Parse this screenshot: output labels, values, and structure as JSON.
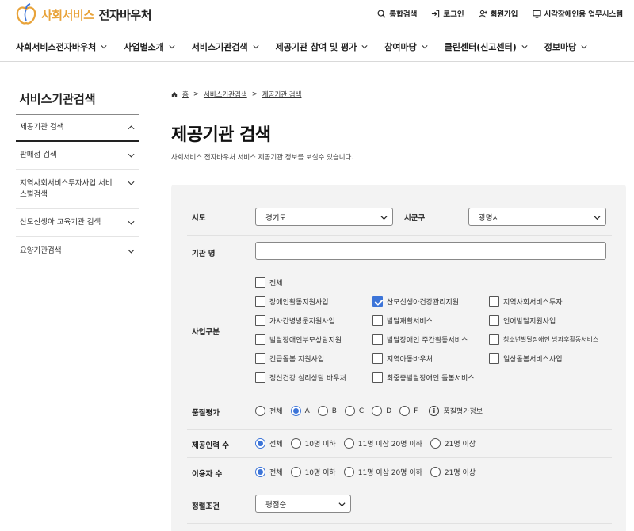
{
  "header": {
    "logo_part1": "사회서비스",
    "logo_part2": "전자바우처",
    "utility": [
      {
        "label": "통합검색",
        "icon": "search-icon"
      },
      {
        "label": "로그인",
        "icon": "login-icon"
      },
      {
        "label": "회원가입",
        "icon": "user-add-icon"
      },
      {
        "label": "시각장애인용 업무시스템",
        "icon": "monitor-icon"
      }
    ]
  },
  "gnb": [
    "사회서비스전자바우처",
    "사업별소개",
    "서비스기관검색",
    "제공기관 참여 및 평가",
    "참여마당",
    "클린센터(신고센터)",
    "정보마당"
  ],
  "sidebar": {
    "title": "서비스기관검색",
    "items": [
      {
        "label": "제공기관 검색",
        "active": true
      },
      {
        "label": "판매점 검색"
      },
      {
        "label": "지역사회서비스투자사업 서비스별검색"
      },
      {
        "label": "산모신생아 교육기관 검색"
      },
      {
        "label": "요양기관검색"
      }
    ]
  },
  "breadcrumb": [
    "홈",
    "서비스기관검색",
    "제공기관 검색"
  ],
  "page": {
    "title": "제공기관 검색",
    "description": "사회서비스 전자바우처 서비스 제공기관 정보를 보실수 있습니다."
  },
  "form": {
    "sido_label": "시도",
    "sido_value": "경기도",
    "sigungu_label": "시군구",
    "sigungu_value": "광명시",
    "name_label": "기관 명",
    "name_value": "",
    "biz_label": "사업구분",
    "biz_options": [
      {
        "label": "전체",
        "checked": false
      },
      {
        "label": "장애인활동지원사업",
        "checked": false
      },
      {
        "label": "산모신생아건강관리지원",
        "checked": true
      },
      {
        "label": "지역사회서비스투자",
        "checked": false
      },
      {
        "label": "가사간병방문지원사업",
        "checked": false
      },
      {
        "label": "발달재활서비스",
        "checked": false
      },
      {
        "label": "언어발달지원사업",
        "checked": false
      },
      {
        "label": "발달장애인부모상담지원",
        "checked": false
      },
      {
        "label": "발달장애인 주간활동서비스",
        "checked": false
      },
      {
        "label": "청소년발달장애인 방과후활동서비스",
        "checked": false
      },
      {
        "label": "긴급돌봄 지원사업",
        "checked": false
      },
      {
        "label": "지역아동바우처",
        "checked": false
      },
      {
        "label": "일상돌봄서비스사업",
        "checked": false
      },
      {
        "label": "정신건강 심리상담 바우처",
        "checked": false
      },
      {
        "label": "최중증발달장애인 돌봄서비스",
        "checked": false
      }
    ],
    "quality_label": "품질평가",
    "quality_options": [
      "전체",
      "A",
      "B",
      "C",
      "D",
      "F"
    ],
    "quality_selected": 1,
    "quality_info": "품질평가정보",
    "staff_label": "제공인력 수",
    "staff_options": [
      "전체",
      "10명 이하",
      "11명 이상 20명 이하",
      "21명 이상"
    ],
    "staff_selected": 0,
    "users_label": "이용자 수",
    "users_options": [
      "전체",
      "10명 이하",
      "11명 이상 20명 이하",
      "21명 이상"
    ],
    "users_selected": 0,
    "sort_label": "정렬조건",
    "sort_value": "평점순"
  },
  "colors": {
    "brand_orange": "#e8a33a",
    "accent_blue": "#3c74d8",
    "panel_bg": "#f3f3f3"
  }
}
